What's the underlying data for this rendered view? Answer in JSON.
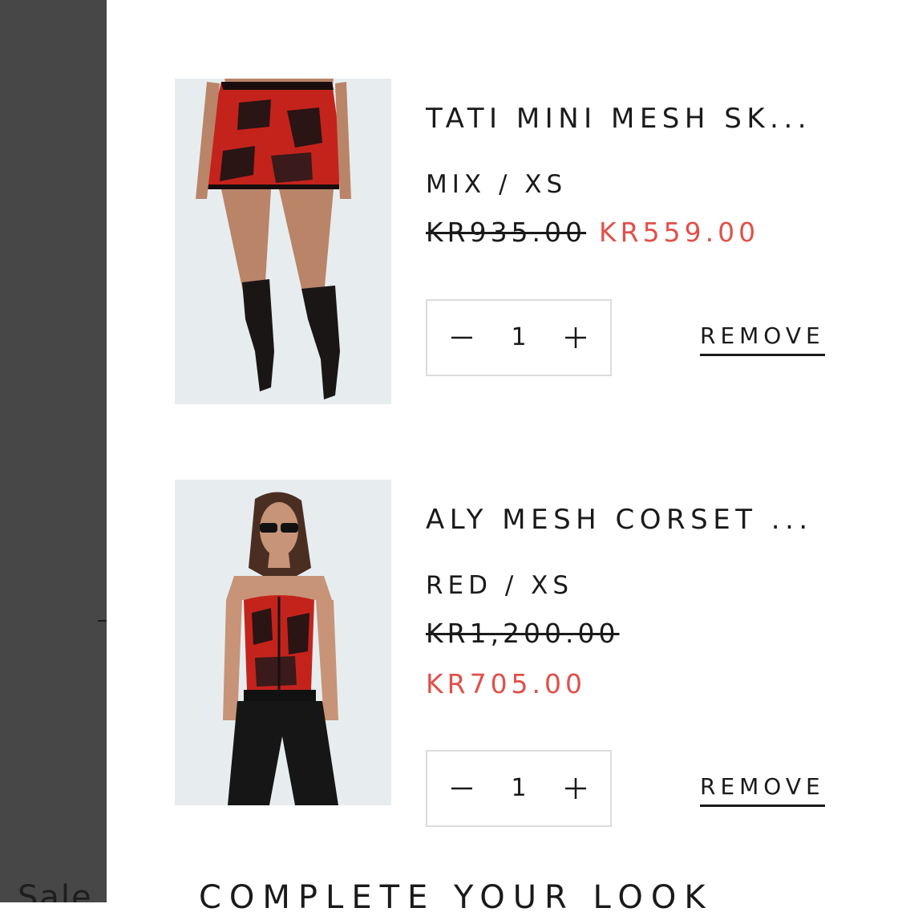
{
  "backdrop": {
    "partial_text": "Sale"
  },
  "cart": {
    "items": [
      {
        "title": "TATI MINI MESH SK...",
        "variant": "MIX / XS",
        "price_original": "KR935.00",
        "price_sale": "KR559.00",
        "quantity": "1",
        "remove_label": "REMOVE",
        "image_icon": "product-photo"
      },
      {
        "title": "ALY MESH CORSET ...",
        "variant": "RED / XS",
        "price_original": "KR1,200.00",
        "price_sale": "KR705.00",
        "quantity": "1",
        "remove_label": "REMOVE",
        "image_icon": "product-photo"
      }
    ],
    "icons": {
      "decrease": "minus-icon",
      "increase": "plus-icon"
    }
  },
  "complete_look": {
    "heading": "COMPLETE YOUR LOOK"
  },
  "colors": {
    "sale": "#e0504a",
    "backdrop": "#474747",
    "text": "#1a1a1a",
    "border": "#dcdcdc"
  }
}
